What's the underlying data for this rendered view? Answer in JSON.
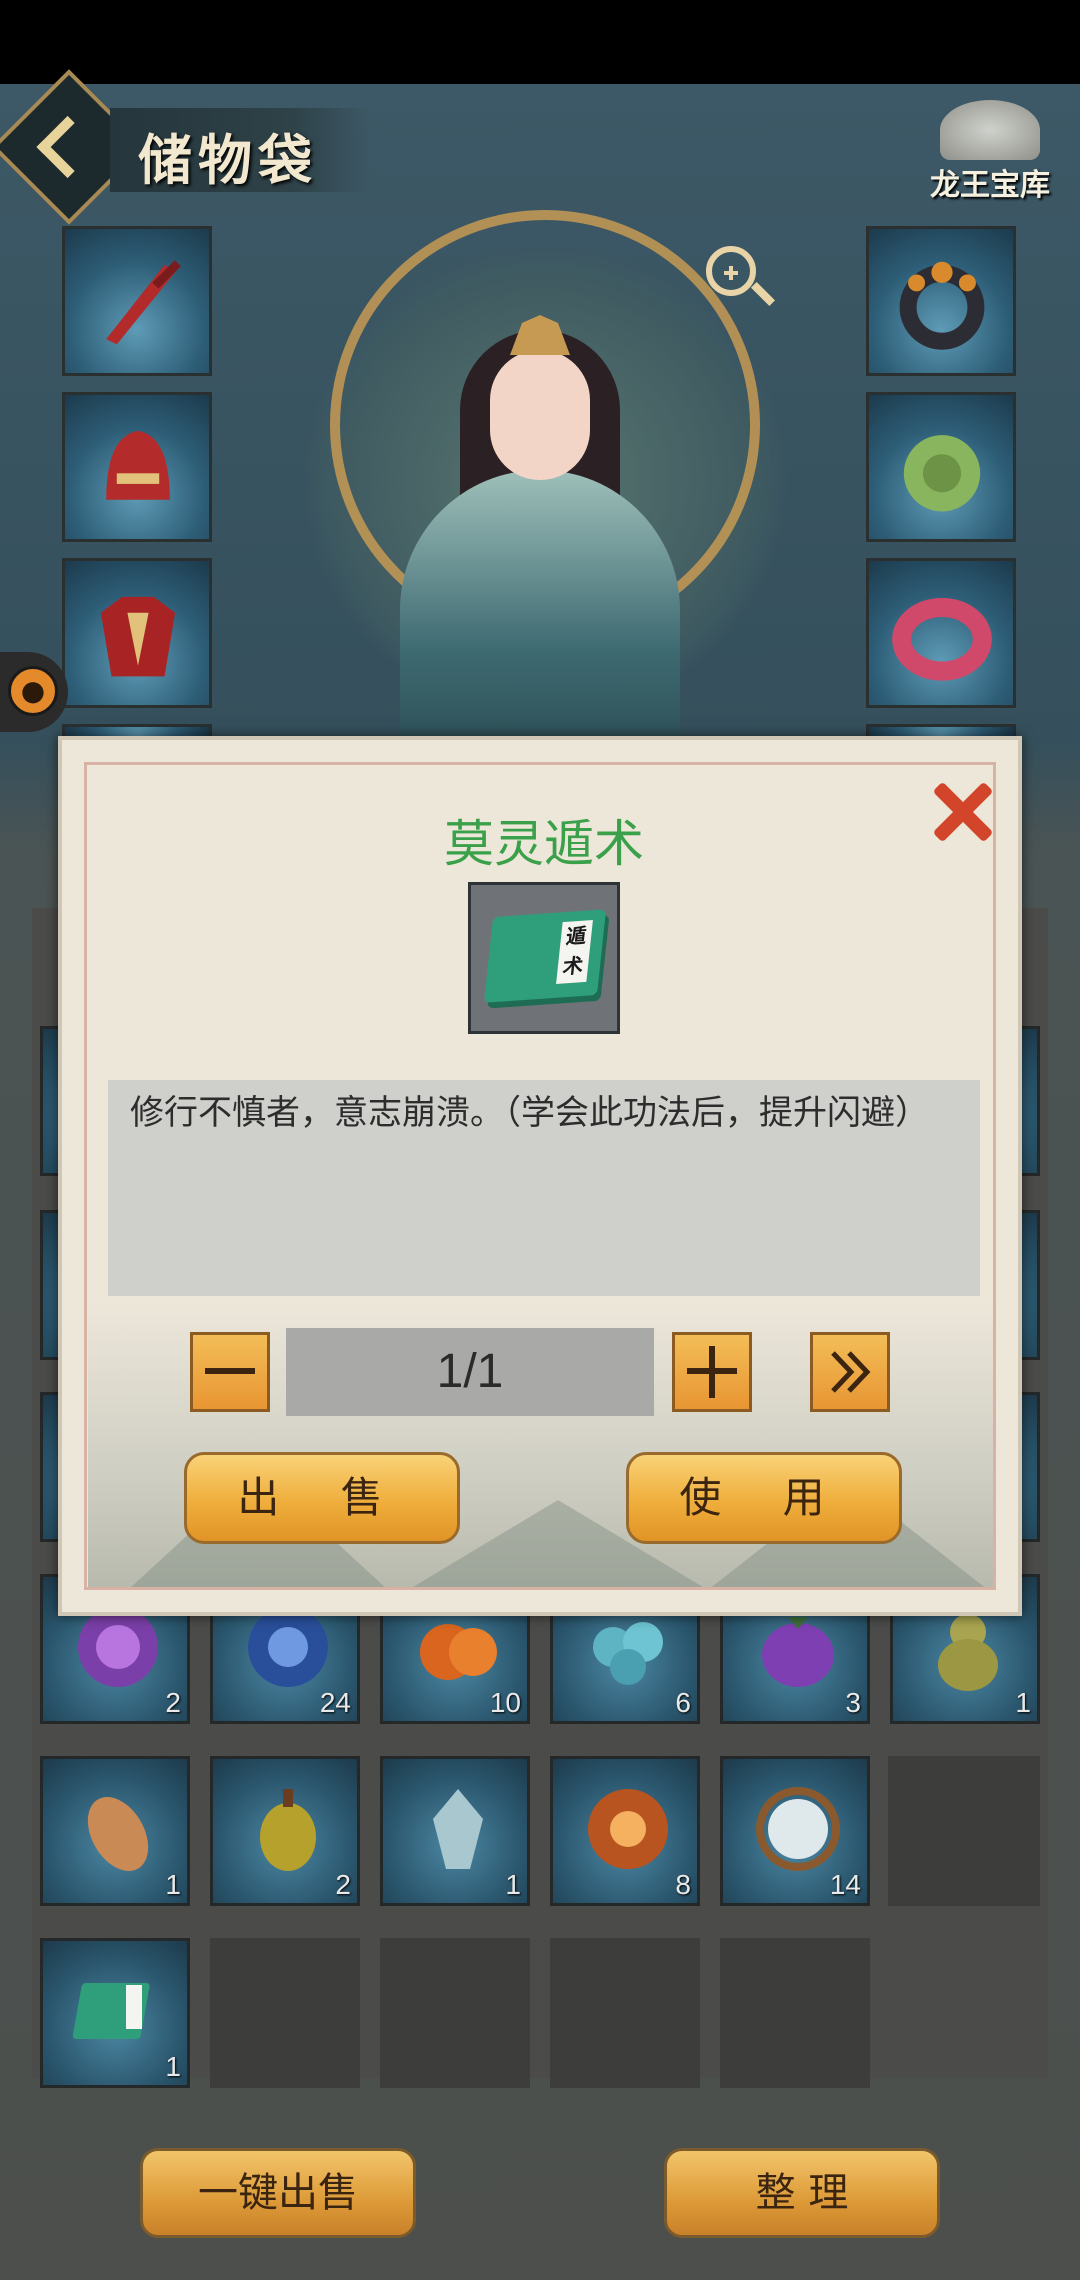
{
  "header": {
    "title": "储物袋",
    "store_label": "龙王宝库"
  },
  "inventory": {
    "rows": [
      [
        {
          "count": "2",
          "icon": "purple-flame-orb-icon"
        },
        {
          "count": "24",
          "icon": "blue-orb-icon"
        },
        {
          "count": "10",
          "icon": "orange-fruit-icon"
        },
        {
          "count": "6",
          "icon": "cyan-berries-icon"
        },
        {
          "count": "3",
          "icon": "purple-fruit-icon"
        },
        {
          "count": "1",
          "icon": "green-gourd-icon"
        }
      ],
      [
        {
          "count": "1",
          "icon": "sweet-potato-icon"
        },
        {
          "count": "2",
          "icon": "yellow-pepper-icon"
        },
        {
          "count": "1",
          "icon": "crystal-icon"
        },
        {
          "count": "8",
          "icon": "fire-orb-icon"
        },
        {
          "count": "14",
          "icon": "root-orb-icon"
        }
      ],
      [
        {
          "count": "1",
          "icon": "technique-book-icon"
        }
      ]
    ],
    "buttons": {
      "sell_all": "一键出售",
      "sort": "整 理"
    }
  },
  "dialog": {
    "item_name": "莫灵遁术",
    "book_label": "遁术",
    "description": "修行不慎者，意志崩溃。（学会此功法后，提升闪避）",
    "quantity": "1/1",
    "sell_label": "出 售",
    "use_label": "使 用",
    "title_color": "#3aa14a"
  }
}
